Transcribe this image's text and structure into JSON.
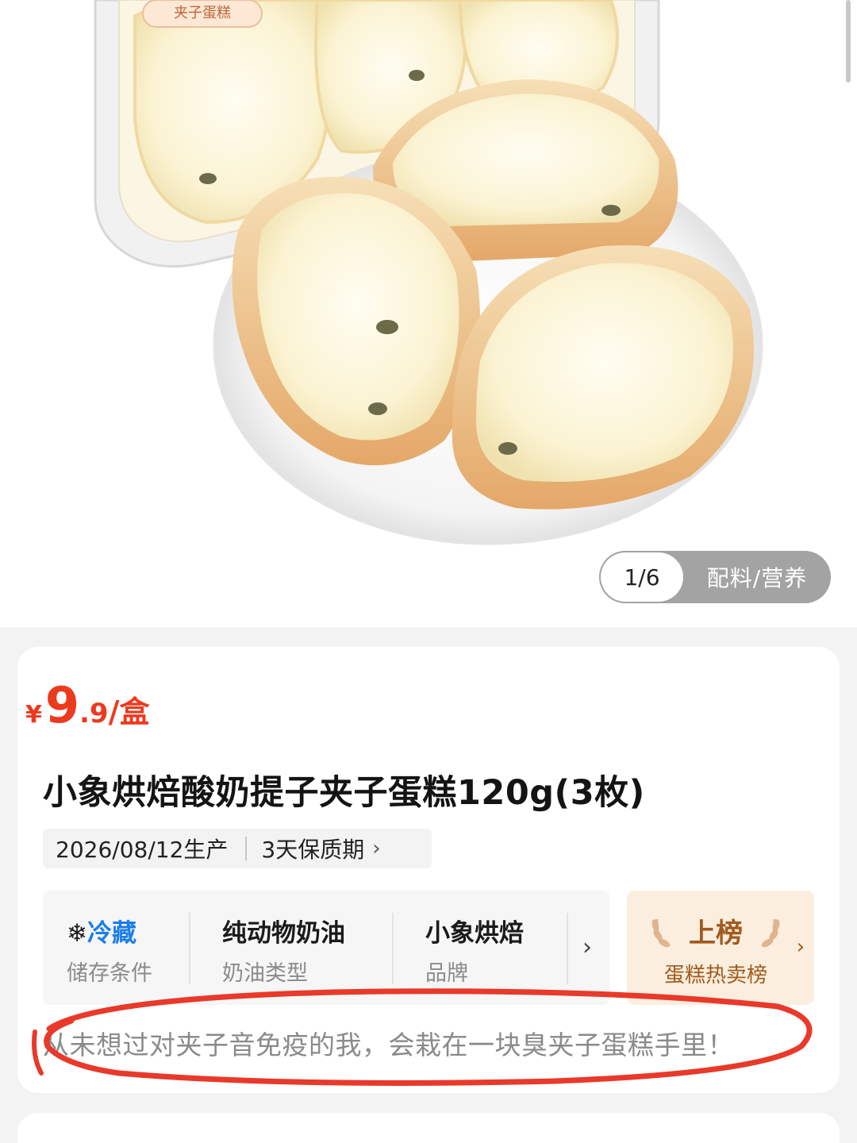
{
  "gallery": {
    "page_indicator": "1/6",
    "nutrition_tab": "配料/营养",
    "package_label": "夹子蛋糕"
  },
  "product": {
    "price": {
      "currency": "¥",
      "integer": "9",
      "decimal": ".9",
      "unit": "/盒"
    },
    "title": "小象烘焙酸奶提子夹子蛋糕120g(3枚)",
    "production_date": "2026/08/12生产",
    "shelf_life": "3天保质期",
    "shelf_life_chevron": "›",
    "attributes": [
      {
        "value": "冷藏",
        "label": "储存条件",
        "icon": "snowflake-icon"
      },
      {
        "value": "纯动物奶油",
        "label": "奶油类型"
      },
      {
        "value": "小象烘焙",
        "label": "品牌"
      }
    ],
    "attributes_chevron": "›",
    "ranking": {
      "title": "上榜",
      "subtitle": "蛋糕热卖榜",
      "chevron": "›",
      "icon": "laurel-icon"
    },
    "description": "从未想过对夹子音免疫的我，会栽在一块臭夹子蛋糕手里！"
  },
  "colors": {
    "price": "#ec3a1e",
    "cold_storage": "#1a7ee8",
    "ranking_text": "#a15a1e",
    "ranking_bg": "#fbeede",
    "annotation": "#e8392a"
  }
}
